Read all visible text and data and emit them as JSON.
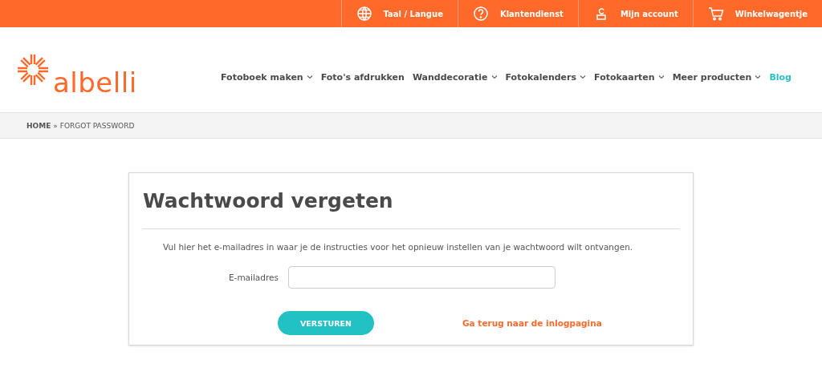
{
  "top_bar": [
    {
      "kind": "globe",
      "label": "Taal / Langue"
    },
    {
      "kind": "help",
      "label": "Klantendienst"
    },
    {
      "kind": "account",
      "label": "Mijn account"
    },
    {
      "kind": "cart",
      "label": "Winkelwagentje"
    }
  ],
  "logo": {
    "text": "albelli"
  },
  "nav": [
    {
      "label": "Fotoboek maken",
      "kind": "menu"
    },
    {
      "label": "Foto's afdrukken",
      "kind": "plain"
    },
    {
      "label": "Wanddecoratie",
      "kind": "menu"
    },
    {
      "label": "Fotokalenders",
      "kind": "menu"
    },
    {
      "label": "Fotokaarten",
      "kind": "menu"
    },
    {
      "label": "Meer producten",
      "kind": "menu"
    },
    {
      "label": "Blog",
      "kind": "highlight"
    }
  ],
  "breadcrumb": {
    "home": "HOME",
    "separator": "»",
    "current": "FORGOT PASSWORD"
  },
  "form": {
    "title": "Wachtwoord vergeten",
    "instructions": "Vul hier het e-mailadres in waar je de instructies voor het opnieuw instellen van je wachtwoord wilt ontvangen.",
    "email_label": "E-mailadres",
    "submit": "VERSTUREN",
    "back_link": "Ga terug naar de inlogpagina"
  }
}
